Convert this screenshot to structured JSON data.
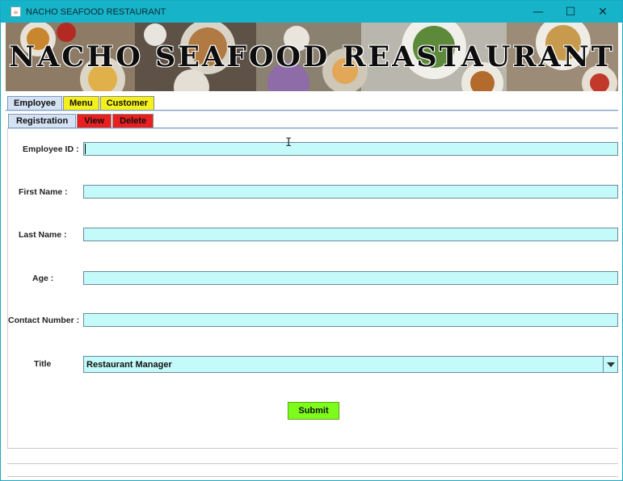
{
  "window": {
    "title": "NACHO SEAFOOD RESTAURANT"
  },
  "banner": {
    "title": "NACHO SEAFOOD REASTAURANT"
  },
  "tabs": [
    {
      "label": "Employee",
      "selected": true
    },
    {
      "label": "Menu"
    },
    {
      "label": "Customer"
    }
  ],
  "subtabs": [
    {
      "label": "Registration",
      "selected": true
    },
    {
      "label": "View"
    },
    {
      "label": "Delete"
    }
  ],
  "form": {
    "employee_id_label": "Employee ID :",
    "first_name_label": "First Name :",
    "last_name_label": "Last Name :",
    "age_label": "Age :",
    "contact_label": "Contact Number :",
    "title_label": "Title",
    "employee_id": "",
    "first_name": "",
    "last_name": "",
    "age": "",
    "contact": "",
    "title_value": "Restaurant Manager",
    "submit_label": "Submit"
  },
  "colors": {
    "titlebar": "#17b3c9",
    "field_bg": "#c4fbfa",
    "tab_yellow": "#f3f01b",
    "tab_red": "#ea1f1f",
    "submit_green": "#7dfc1c"
  }
}
